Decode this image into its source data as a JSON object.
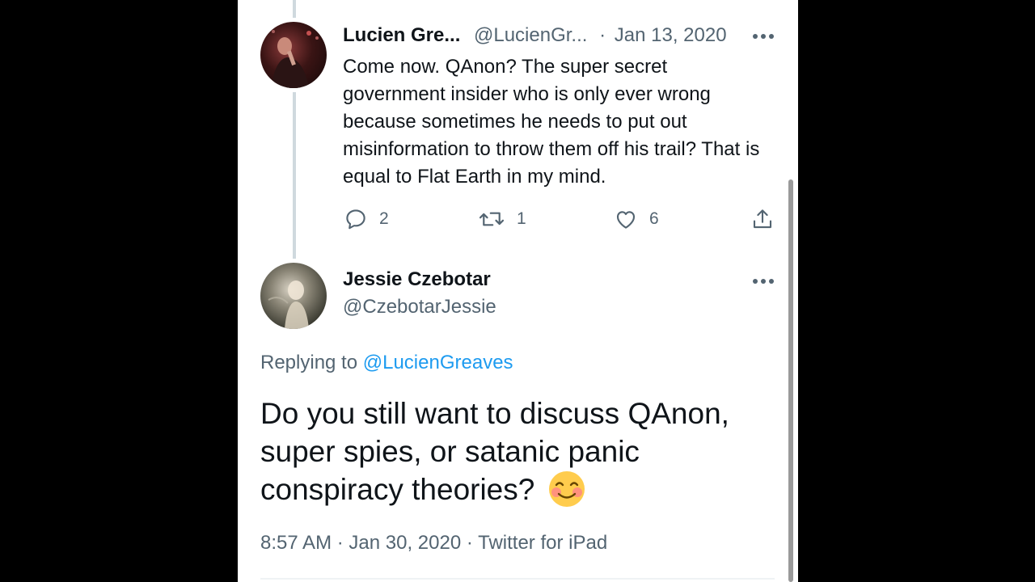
{
  "colors": {
    "text_primary": "#0f1419",
    "text_secondary": "#536471",
    "link": "#1d9bf0",
    "thread_line": "#cfd9de",
    "background": "#ffffff"
  },
  "parent_tweet": {
    "author_name": "Lucien Gre...",
    "author_handle": "@LucienGr...",
    "separator": "·",
    "date": "Jan 13, 2020",
    "more_icon": "more-horizontal-icon",
    "text": "Come now. QAnon? The super secret government insider who is only ever wrong because sometimes he needs to put out misinformation to throw them off his trail? That is equal to Flat Earth in my mind.",
    "actions": {
      "reply_count": "2",
      "retweet_count": "1",
      "like_count": "6"
    }
  },
  "focused_tweet": {
    "author_name": "Jessie Czebotar",
    "author_handle": "@CzebotarJessie",
    "more_icon": "more-horizontal-icon",
    "replying_prefix": "Replying to",
    "replying_handle": "@LucienGreaves",
    "text": "Do you still want to discuss QAnon, super spies, or satanic panic conspiracy theories?",
    "emoji": "smiling-face-with-smiling-eyes",
    "meta": {
      "time": "8:57 AM",
      "date": "Jan 30, 2020",
      "source": "Twitter for iPad",
      "separator": "·"
    }
  }
}
